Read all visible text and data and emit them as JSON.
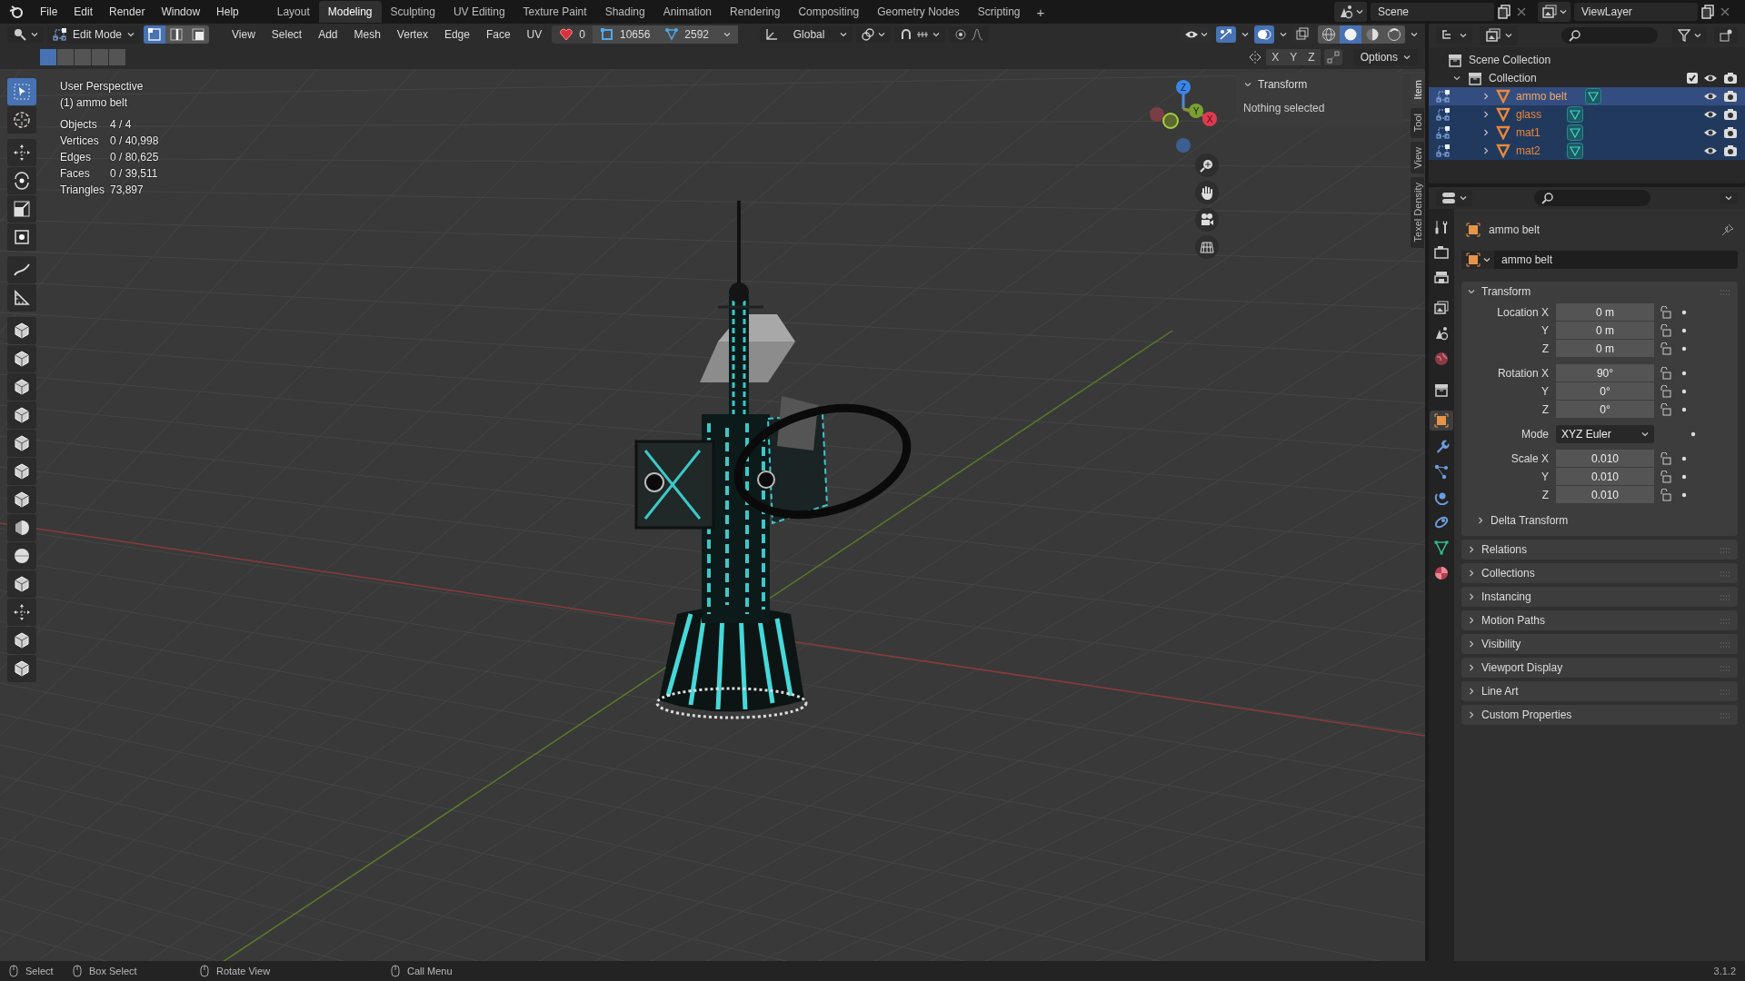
{
  "top_bar": {
    "menus": [
      "File",
      "Edit",
      "Render",
      "Window",
      "Help"
    ],
    "workspaces": [
      {
        "label": "Layout",
        "selected": false
      },
      {
        "label": "Modeling",
        "selected": true
      },
      {
        "label": "Sculpting",
        "selected": false
      },
      {
        "label": "UV Editing",
        "selected": false
      },
      {
        "label": "Texture Paint",
        "selected": false
      },
      {
        "label": "Shading",
        "selected": false
      },
      {
        "label": "Animation",
        "selected": false
      },
      {
        "label": "Rendering",
        "selected": false
      },
      {
        "label": "Compositing",
        "selected": false
      },
      {
        "label": "Geometry Nodes",
        "selected": false
      },
      {
        "label": "Scripting",
        "selected": false
      }
    ],
    "add_tab": "+",
    "scene": "Scene",
    "view_layer": "ViewLayer"
  },
  "viewport": {
    "header": {
      "editor_mode": "Edit Mode",
      "select_modes": [
        {
          "kind": "vertex",
          "selected": true
        },
        {
          "kind": "edge",
          "selected": false
        },
        {
          "kind": "face",
          "selected": false
        }
      ],
      "menus": [
        "View",
        "Select",
        "Add",
        "Mesh",
        "Vertex",
        "Edge",
        "Face",
        "UV"
      ],
      "counters": [
        {
          "kind": "heart",
          "value": "0"
        },
        {
          "kind": "square",
          "value": "10656"
        },
        {
          "kind": "triangle",
          "value": "2592"
        }
      ],
      "orientation": "Global",
      "shading": [
        {
          "kind": "wireframe",
          "selected": false
        },
        {
          "kind": "solid",
          "selected": true
        },
        {
          "kind": "material",
          "selected": false
        },
        {
          "kind": "rendered",
          "selected": false
        }
      ]
    },
    "tool_settings": {
      "axes": [
        "X",
        "Y",
        "Z"
      ],
      "options": "Options"
    },
    "info": {
      "view": "User Perspective",
      "object": "(1) ammo belt",
      "stats": [
        {
          "label": "Objects",
          "value": "4 / 4"
        },
        {
          "label": "Vertices",
          "value": "0 / 40,998"
        },
        {
          "label": "Edges",
          "value": "0 / 80,625"
        },
        {
          "label": "Faces",
          "value": "0 / 39,511"
        },
        {
          "label": "Triangles",
          "value": "73,897"
        }
      ]
    },
    "tool_groups": [
      {
        "tools": [
          {
            "kind": "select",
            "selected": true
          },
          {
            "kind": "cursor",
            "selected": false
          }
        ]
      },
      {
        "tools": [
          {
            "kind": "move",
            "selected": false
          },
          {
            "kind": "rotate",
            "selected": false
          },
          {
            "kind": "scale",
            "selected": false
          },
          {
            "kind": "transform",
            "selected": false
          }
        ]
      },
      {
        "tools": [
          {
            "kind": "annotate",
            "selected": false
          },
          {
            "kind": "measure",
            "selected": false
          }
        ]
      },
      {
        "tools": [
          {
            "kind": "cube",
            "selected": false
          },
          {
            "kind": "cube",
            "selected": false
          },
          {
            "kind": "cube",
            "selected": false
          },
          {
            "kind": "cube",
            "selected": false
          },
          {
            "kind": "cube",
            "selected": false
          },
          {
            "kind": "cube",
            "selected": false
          },
          {
            "kind": "cube",
            "selected": false
          },
          {
            "kind": "spin",
            "selected": false
          },
          {
            "kind": "sphere",
            "selected": false
          },
          {
            "kind": "cube",
            "selected": false
          },
          {
            "kind": "move",
            "selected": false
          },
          {
            "kind": "cube",
            "selected": false
          },
          {
            "kind": "cube",
            "selected": false
          }
        ]
      }
    ],
    "gizmo": {
      "axes": [
        "Z",
        "Y",
        "X"
      ]
    },
    "sidebar": {
      "panel": {
        "title": "Transform",
        "expanded": true,
        "message": "Nothing selected"
      },
      "tabs": [
        {
          "label": "Item",
          "selected": true
        },
        {
          "label": "Tool",
          "selected": false
        },
        {
          "label": "View",
          "selected": false
        },
        {
          "label": "Texel Density",
          "selected": false
        }
      ]
    }
  },
  "outliner": {
    "root": "Scene Collection",
    "collection": {
      "name": "Collection",
      "expanded": true,
      "checked": true,
      "children": [
        {
          "name": "ammo belt",
          "active": true
        },
        {
          "name": "glass",
          "active": false
        },
        {
          "name": "mat1",
          "active": false
        },
        {
          "name": "mat2",
          "active": false
        }
      ]
    }
  },
  "properties": {
    "tabs": [
      {
        "kind": "tool",
        "selected": false
      },
      {
        "kind": "render",
        "selected": false
      },
      {
        "kind": "output",
        "selected": false
      },
      {
        "kind": "view_layer",
        "selected": false
      },
      {
        "kind": "scene",
        "selected": false
      },
      {
        "kind": "world",
        "selected": false
      },
      {
        "kind": "collection",
        "selected": false
      },
      {
        "kind": "object",
        "selected": true
      },
      {
        "kind": "modifiers",
        "selected": false
      },
      {
        "kind": "particles",
        "selected": false
      },
      {
        "kind": "physics",
        "selected": false
      },
      {
        "kind": "constraints",
        "selected": false
      },
      {
        "kind": "data",
        "selected": false
      },
      {
        "kind": "material",
        "selected": false
      }
    ],
    "object": "ammo belt",
    "object_field": "ammo belt",
    "transform": {
      "title": "Transform",
      "expanded": true,
      "groups": [
        {
          "rows": [
            {
              "kind": "field",
              "label": "Location X",
              "value": "0 m"
            },
            {
              "kind": "field",
              "label": "Y",
              "value": "0 m"
            },
            {
              "kind": "field",
              "label": "Z",
              "value": "0 m"
            }
          ]
        },
        {
          "rows": [
            {
              "kind": "field",
              "label": "Rotation X",
              "value": "90°"
            },
            {
              "kind": "field",
              "label": "Y",
              "value": "0°"
            },
            {
              "kind": "field",
              "label": "Z",
              "value": "0°"
            }
          ]
        },
        {
          "rows": [
            {
              "kind": "dropdown",
              "label": "Mode",
              "value": "XYZ Euler"
            }
          ]
        },
        {
          "rows": [
            {
              "kind": "field",
              "label": "Scale X",
              "value": "0.010"
            },
            {
              "kind": "field",
              "label": "Y",
              "value": "0.010"
            },
            {
              "kind": "field",
              "label": "Z",
              "value": "0.010"
            }
          ]
        }
      ],
      "subpanels": [
        {
          "title": "Delta Transform",
          "expanded": false
        }
      ]
    },
    "panels": [
      {
        "title": "Relations",
        "expanded": false
      },
      {
        "title": "Collections",
        "expanded": false
      },
      {
        "title": "Instancing",
        "expanded": false
      },
      {
        "title": "Motion Paths",
        "expanded": false
      },
      {
        "title": "Visibility",
        "expanded": false
      },
      {
        "title": "Viewport Display",
        "expanded": false
      },
      {
        "title": "Line Art",
        "expanded": false
      },
      {
        "title": "Custom Properties",
        "expanded": false
      }
    ]
  },
  "status_bar": {
    "hints": [
      {
        "label": "Select"
      },
      {
        "label": "Box Select"
      },
      {
        "label": "Rotate View"
      },
      {
        "label": "Call Menu"
      }
    ],
    "version": "3.1.2"
  }
}
